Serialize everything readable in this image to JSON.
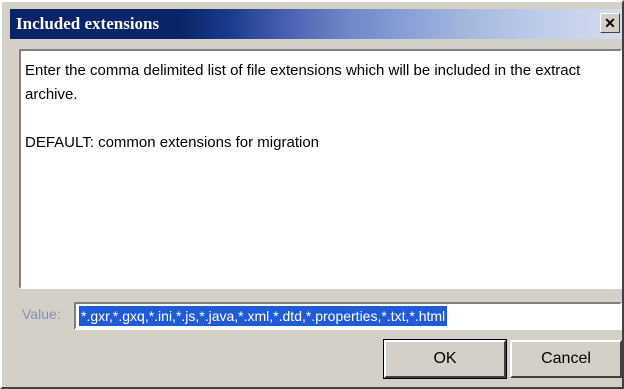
{
  "window": {
    "title": "Included extensions",
    "close_glyph": "✕"
  },
  "description": {
    "line1": "Enter the comma delimited list of file extensions which will be included in the extract archive.",
    "line2": "DEFAULT: common extensions for migration"
  },
  "value_field": {
    "label": "Value:",
    "value": "*.gxr,*.gxq,*.ini,*.js,*.java,*.xml,*.dtd,*.properties,*.txt,*.html"
  },
  "buttons": {
    "ok_label": "OK",
    "cancel_label": "Cancel"
  },
  "colors": {
    "title_bar_start": "#0a246a",
    "selection": "#1f5bd6",
    "dialog_face": "#d4d0c8"
  },
  "icons": {
    "close": "close-icon"
  }
}
